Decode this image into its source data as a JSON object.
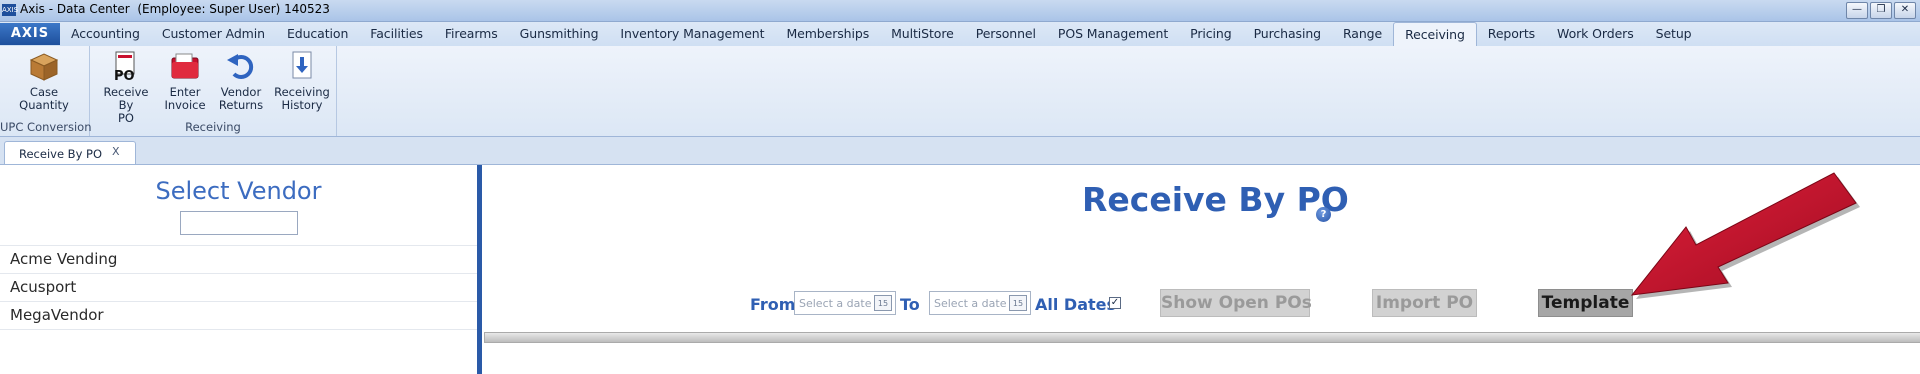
{
  "window": {
    "title": "Axis - Data Center  (Employee: Super User) 140523",
    "app_icon": "AXIS",
    "controls": [
      "minimize-icon",
      "restore-icon",
      "close-icon"
    ]
  },
  "ribbon": {
    "logo": "AXIS",
    "tabs": [
      {
        "label": "Accounting"
      },
      {
        "label": "Customer Admin"
      },
      {
        "label": "Education"
      },
      {
        "label": "Facilities"
      },
      {
        "label": "Firearms"
      },
      {
        "label": "Gunsmithing"
      },
      {
        "label": "Inventory Management"
      },
      {
        "label": "Memberships"
      },
      {
        "label": "MultiStore"
      },
      {
        "label": "Personnel"
      },
      {
        "label": "POS Management"
      },
      {
        "label": "Pricing"
      },
      {
        "label": "Purchasing"
      },
      {
        "label": "Range"
      },
      {
        "label": "Receiving",
        "active": true
      },
      {
        "label": "Reports"
      },
      {
        "label": "Work Orders"
      },
      {
        "label": "Setup"
      }
    ],
    "groups": [
      {
        "label": "UPC Conversion",
        "buttons": [
          {
            "line1": "Case",
            "line2": "Quantity",
            "icon": "box-icon"
          }
        ]
      },
      {
        "label": "Receiving",
        "buttons": [
          {
            "line1": "Receive By",
            "line2": "PO",
            "icon": "po-document-icon"
          },
          {
            "line1": "Enter",
            "line2": "Invoice",
            "icon": "red-folder-icon"
          },
          {
            "line1": "Vendor",
            "line2": "Returns",
            "icon": "return-arrow-icon"
          },
          {
            "line1": "Receiving",
            "line2": "History",
            "icon": "download-history-icon"
          }
        ]
      }
    ]
  },
  "doc_tabs": [
    {
      "label": "Receive By PO",
      "close": "X"
    }
  ],
  "vendor_panel": {
    "title": "Select Vendor",
    "search_value": "",
    "vendors": [
      "Acme Vending",
      "Acusport",
      "MegaVendor"
    ]
  },
  "main": {
    "title": "Receive By PO",
    "help_icon": "?",
    "filters": {
      "from_label": "From",
      "from_placeholder": "Select a date",
      "to_label": "To",
      "to_placeholder": "Select a date",
      "calendar_glyph": "15",
      "all_dates_label": "All Dates",
      "all_dates_checked": true,
      "check_glyph": "✓"
    },
    "buttons": {
      "show_open_pos": "Show Open POs",
      "import_po": "Import PO",
      "template": "Template"
    },
    "annotation": "red-arrow-pointing-to-template"
  },
  "colors": {
    "accent_blue": "#2f5fb3",
    "arrow_red": "#c8102e",
    "disabled_button": "#d2d2d2",
    "enabled_button": "#a6a6a6"
  }
}
